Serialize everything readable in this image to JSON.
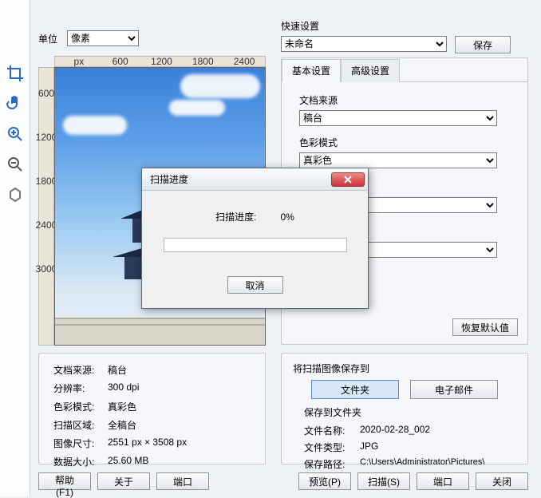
{
  "unit": {
    "label": "单位",
    "value": "像素"
  },
  "quick": {
    "label": "快速设置",
    "value": "未命名",
    "save_btn": "保存"
  },
  "tabs": {
    "basic": "基本设置",
    "advanced": "高级设置"
  },
  "basic": {
    "source_label": "文档来源",
    "source_value": "稿台",
    "color_label": "色彩模式",
    "color_value": "真彩色",
    "restore_btn": "恢复默认值"
  },
  "info": {
    "source_k": "文档来源:",
    "source_v": "稿台",
    "dpi_k": "分辨率:",
    "dpi_v": "300 dpi",
    "color_k": "色彩模式:",
    "color_v": "真彩色",
    "area_k": "扫描区域:",
    "area_v": "全稿台",
    "size_k": "图像尺寸:",
    "size_v": "2551 px × 3508 px",
    "data_k": "数据大小:",
    "data_v": "25.60 MB"
  },
  "save": {
    "title": "将扫描图像保存到",
    "folder_btn": "文件夹",
    "email_btn": "电子邮件",
    "sub": "保存到文件夹",
    "name_k": "文件名称:",
    "name_v": "2020-02-28_002",
    "type_k": "文件类型:",
    "type_v": "JPG",
    "path_k": "保存路径:",
    "path_v": "C:\\Users\\Administrator\\Pictures\\"
  },
  "bottom": {
    "help": "帮助(F1)",
    "about": "关于",
    "port": "端口",
    "preview": "预览(P)",
    "scan": "扫描(S)",
    "port2": "端口",
    "close": "关闭"
  },
  "ruler": {
    "px": "px",
    "x": [
      "600",
      "1200",
      "1800",
      "2400"
    ],
    "y": [
      "600",
      "1200",
      "1800",
      "2400",
      "3000"
    ]
  },
  "dialog": {
    "title": "扫描进度",
    "progress_label": "扫描进度:",
    "progress_value": "0%",
    "cancel_btn": "取消"
  }
}
